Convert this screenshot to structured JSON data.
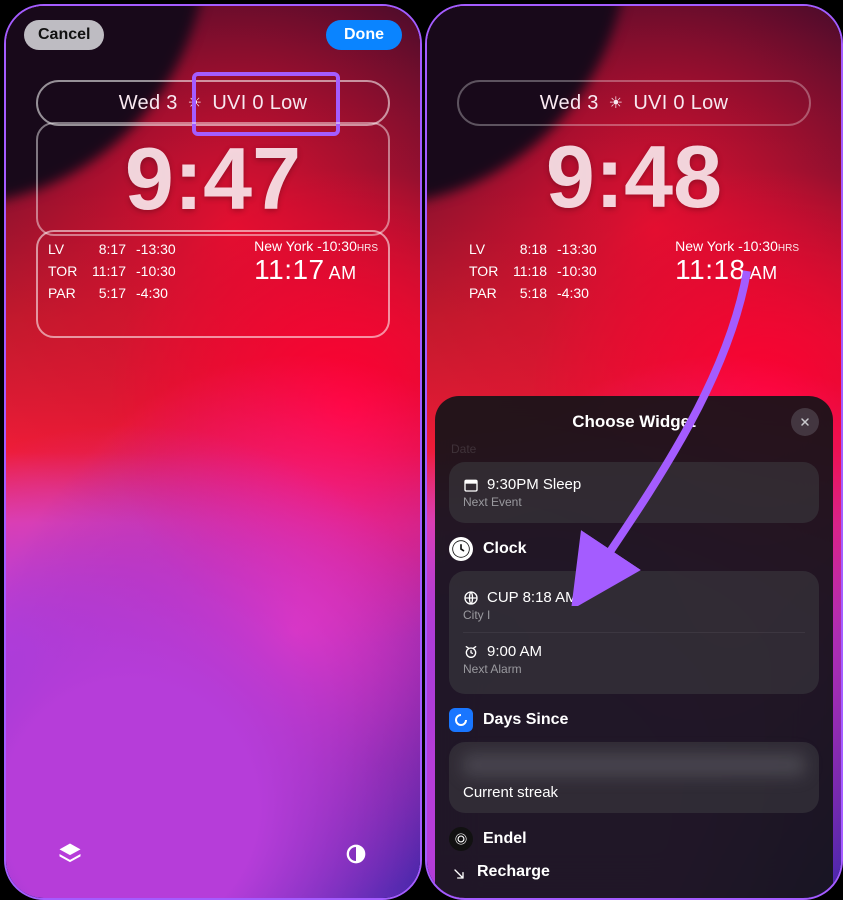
{
  "left": {
    "topbar": {
      "cancel": "Cancel",
      "done": "Done"
    },
    "date": {
      "day": "Wed 3",
      "uvi": "UVI 0 Low"
    },
    "clock": "9:47",
    "world": {
      "rows": [
        {
          "city": "LV",
          "t1": "8:17",
          "t2": "-13:30"
        },
        {
          "city": "TOR",
          "t1": "11:17",
          "t2": "-10:30"
        },
        {
          "city": "PAR",
          "t1": "5:17",
          "t2": "-4:30"
        }
      ],
      "right": {
        "label": "New York",
        "offset": "-10:30",
        "hrs": "HRS",
        "time": "11:17",
        "ampm": "AM"
      }
    }
  },
  "right": {
    "date": {
      "day": "Wed 3",
      "uvi": "UVI 0 Low"
    },
    "clock": "9:48",
    "world": {
      "rows": [
        {
          "city": "LV",
          "t1": "8:18",
          "t2": "-13:30"
        },
        {
          "city": "TOR",
          "t1": "11:18",
          "t2": "-10:30"
        },
        {
          "city": "PAR",
          "t1": "5:18",
          "t2": "-4:30"
        }
      ],
      "right": {
        "label": "New York",
        "offset": "-10:30",
        "hrs": "HRS",
        "time": "11:18",
        "ampm": "AM"
      }
    },
    "sheet": {
      "title": "Choose Widget",
      "faded_section": "Date",
      "next_event": {
        "line": "9:30PM Sleep",
        "sub": "Next Event"
      },
      "clock_section": "Clock",
      "city": {
        "line": "CUP 8:18 AM",
        "sub": "City I"
      },
      "alarm": {
        "line": "9:00 AM",
        "sub": "Next Alarm"
      },
      "days_since": {
        "title": "Days Since",
        "sub": "Current streak"
      },
      "endel": "Endel",
      "recharge": "Recharge"
    }
  }
}
